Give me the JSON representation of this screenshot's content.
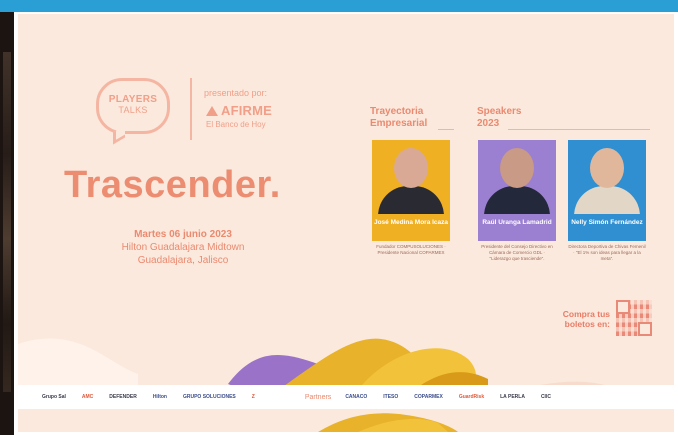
{
  "logo": {
    "players_title": "PLAYERS",
    "players_sub": "TALKS",
    "presented_by": "presentado por:",
    "sponsor_name": "AFIRME",
    "sponsor_tagline": "El Banco de Hoy"
  },
  "event": {
    "title": "Trascender.",
    "date": "Martes 06 junio 2023",
    "venue": "Hilton Guadalajara Midtown",
    "city": "Guadalajara, Jalisco"
  },
  "sections": {
    "trajectory": "Trayectoria Empresarial",
    "speakers": "Speakers 2023"
  },
  "speakers": [
    {
      "name": "José Medina Mora Icaza",
      "description": "Fundador COMPUSOLUCIONES · Presidente Nacional COPARMEX",
      "color": "#f0b024"
    },
    {
      "name": "Raúl Uranga Lamadrid",
      "description": "Presidente del Consejo Directivo en Cámara de Comercio GDL · \"Liderazgo que trasciende\".",
      "color": "#9b7fd0"
    },
    {
      "name": "Nelly Simón Fernández",
      "description": "Directora Deportiva de Chivas Femenil · \"El 1% son ideas para llegar a la meta\".",
      "color": "#2f8fd0"
    }
  ],
  "tickets": {
    "label": "Compra tus boletos en:"
  },
  "partners": {
    "label": "Partners",
    "logos_left": [
      "Grupo Sal",
      "AMC",
      "DEFENDER",
      "Hilton",
      "GRUPO SOLUCIONES",
      "Z"
    ],
    "logos_right": [
      "CANACO",
      "ITESO",
      "COPARMEX",
      "GuardRisk",
      "LA PERLA",
      "CIIC"
    ]
  },
  "colors": {
    "accent": "#ec8d72",
    "background": "#fbe9dd",
    "topbar": "#2a9fd6"
  }
}
